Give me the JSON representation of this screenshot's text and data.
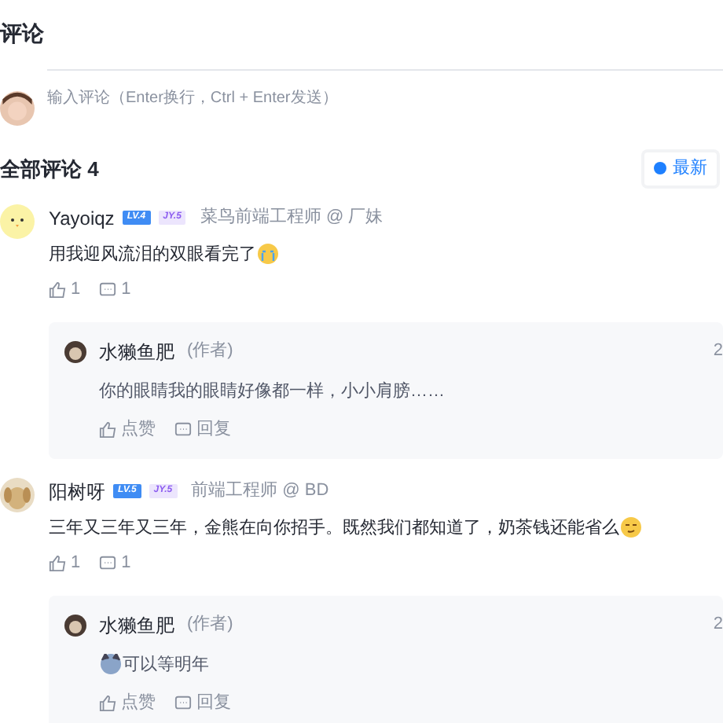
{
  "title": "评论",
  "input": {
    "placeholder": "输入评论（Enter换行，Ctrl + Enter发送）"
  },
  "list_header": {
    "title": "全部评论 4"
  },
  "sort_tabs": [
    {
      "label": "最新",
      "selected": true
    }
  ],
  "comments": [
    {
      "name": "Yayoiqz",
      "level": "LV.4",
      "jy": "JY.5",
      "title": "菜鸟前端工程师 @ 厂妹",
      "text": "用我迎风流泪的双眼看完了",
      "likes": "1",
      "replies_count": "1",
      "replies": [
        {
          "name": "水獭鱼肥",
          "tag": "(作者)",
          "time": "2",
          "text": "你的眼睛我的眼睛好像都一样，小小肩膀……",
          "emoji_before": false,
          "like_label": "点赞",
          "reply_label": "回复"
        }
      ]
    },
    {
      "name": "阳树呀",
      "level": "LV.5",
      "jy": "JY.5",
      "title": "前端工程师 @ BD",
      "text": "三年又三年又三年，金熊在向你招手。既然我们都知道了，奶茶钱还能省么",
      "likes": "1",
      "replies_count": "1",
      "replies": [
        {
          "name": "水獭鱼肥",
          "tag": "(作者)",
          "time": "2",
          "text": "可以等明年",
          "emoji_before": true,
          "like_label": "点赞",
          "reply_label": "回复"
        }
      ]
    }
  ]
}
